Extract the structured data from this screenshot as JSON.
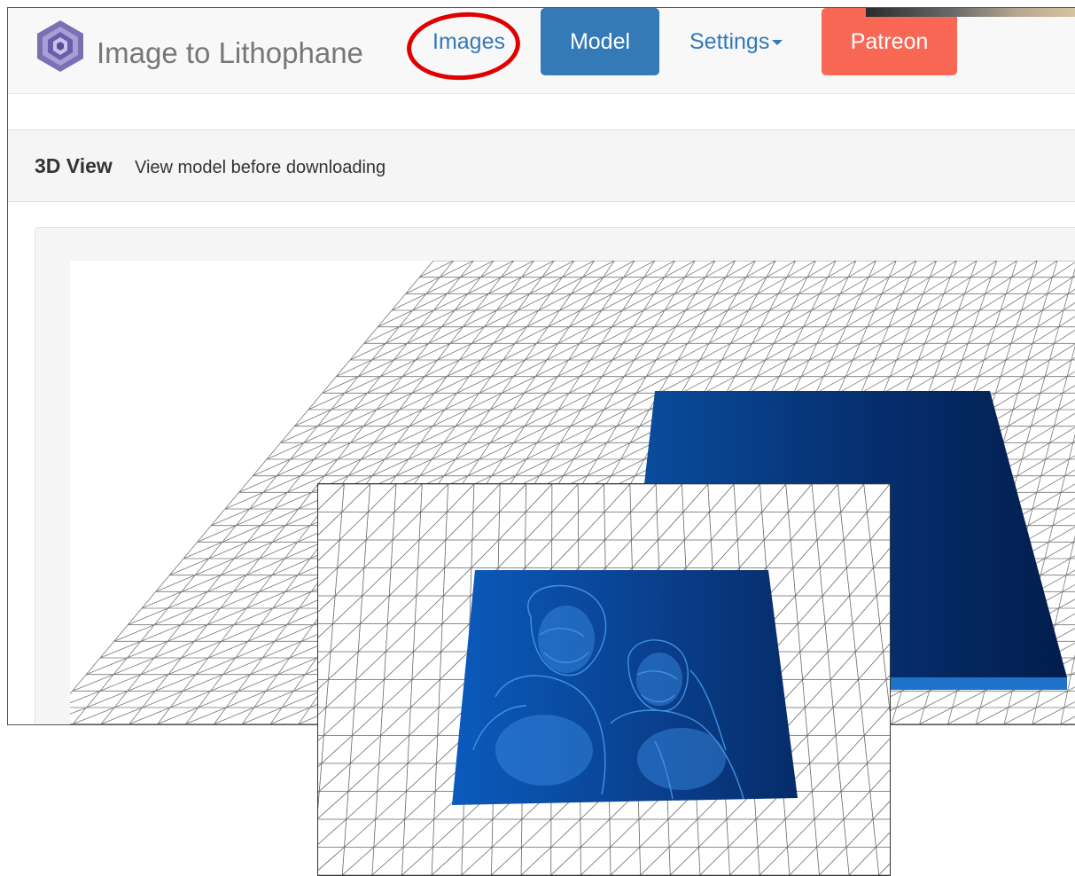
{
  "navbar": {
    "brand": "Image to Lithophane",
    "links": {
      "images": "Images",
      "model": "Model",
      "settings": "Settings",
      "patreon": "Patreon"
    }
  },
  "panel": {
    "title": "3D View",
    "subtitle": "View model before downloading"
  },
  "icons": {
    "brand_logo": "hexagon-logo-icon",
    "settings_caret": "caret-down-icon"
  },
  "colors": {
    "primary": "#337ab7",
    "patreon": "#f96854",
    "annotation": "#e00000",
    "model_blue": "#0a3d8a"
  }
}
